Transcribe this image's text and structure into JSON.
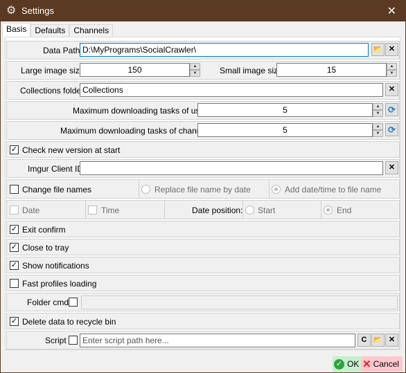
{
  "window": {
    "title": "Settings",
    "close_glyph": "✕"
  },
  "tabs": [
    {
      "label": "Basis",
      "active": true
    },
    {
      "label": "Defaults",
      "active": false
    },
    {
      "label": "Channels",
      "active": false
    }
  ],
  "basis": {
    "data_path": {
      "label": "Data Path",
      "value": "D:\\MyPrograms\\SocialCrawler\\"
    },
    "large_image_size": {
      "label": "Large image size",
      "value": "150"
    },
    "small_image_size": {
      "label": "Small image size",
      "value": "15"
    },
    "collections_folder": {
      "label": "Collections folder",
      "value": "Collections"
    },
    "max_tasks_users": {
      "label": "Maximum downloading tasks of users",
      "value": "5"
    },
    "max_tasks_channels": {
      "label": "Maximum downloading tasks of channels",
      "value": "5"
    },
    "check_version": {
      "label": "Check new version at start",
      "checked": true
    },
    "imgur_client_id": {
      "label": "Imgur Client ID",
      "value": ""
    },
    "change_file_names": {
      "label": "Change file names",
      "checked": false
    },
    "replace_file_name": {
      "label": "Replace file name by date",
      "selected": false
    },
    "add_date_time": {
      "label": "Add date/time to file name",
      "selected": true
    },
    "date": {
      "label": "Date",
      "checked": false
    },
    "time": {
      "label": "Time",
      "checked": false
    },
    "date_position": {
      "label": "Date position:",
      "start": "Start",
      "end": "End",
      "selected": "End"
    },
    "exit_confirm": {
      "label": "Exit confirm",
      "checked": true
    },
    "close_to_tray": {
      "label": "Close to tray",
      "checked": true
    },
    "show_notifications": {
      "label": "Show notifications",
      "checked": true
    },
    "fast_profiles_loading": {
      "label": "Fast profiles loading",
      "checked": false
    },
    "folder_cmd": {
      "label": "Folder cmd",
      "checked": false,
      "value": ""
    },
    "delete_to_recycle_bin": {
      "label": "Delete data to recycle bin",
      "checked": true
    },
    "script": {
      "label": "Script",
      "checked": false,
      "placeholder": "Enter script path here...",
      "c_button": "C"
    }
  },
  "footer": {
    "ok_label": "OK",
    "cancel_label": "Cancel"
  },
  "glyphs": {
    "check": "✓",
    "clear": "✕",
    "folder": "📂",
    "refresh": "⟳",
    "up": "▲",
    "down": "▼",
    "gear": "⚙"
  },
  "colors": {
    "titlebar": "#5a3a22",
    "ok_bg": "#c6efce",
    "cancel_bg": "#ffc7ce",
    "focus": "#0078d7"
  }
}
